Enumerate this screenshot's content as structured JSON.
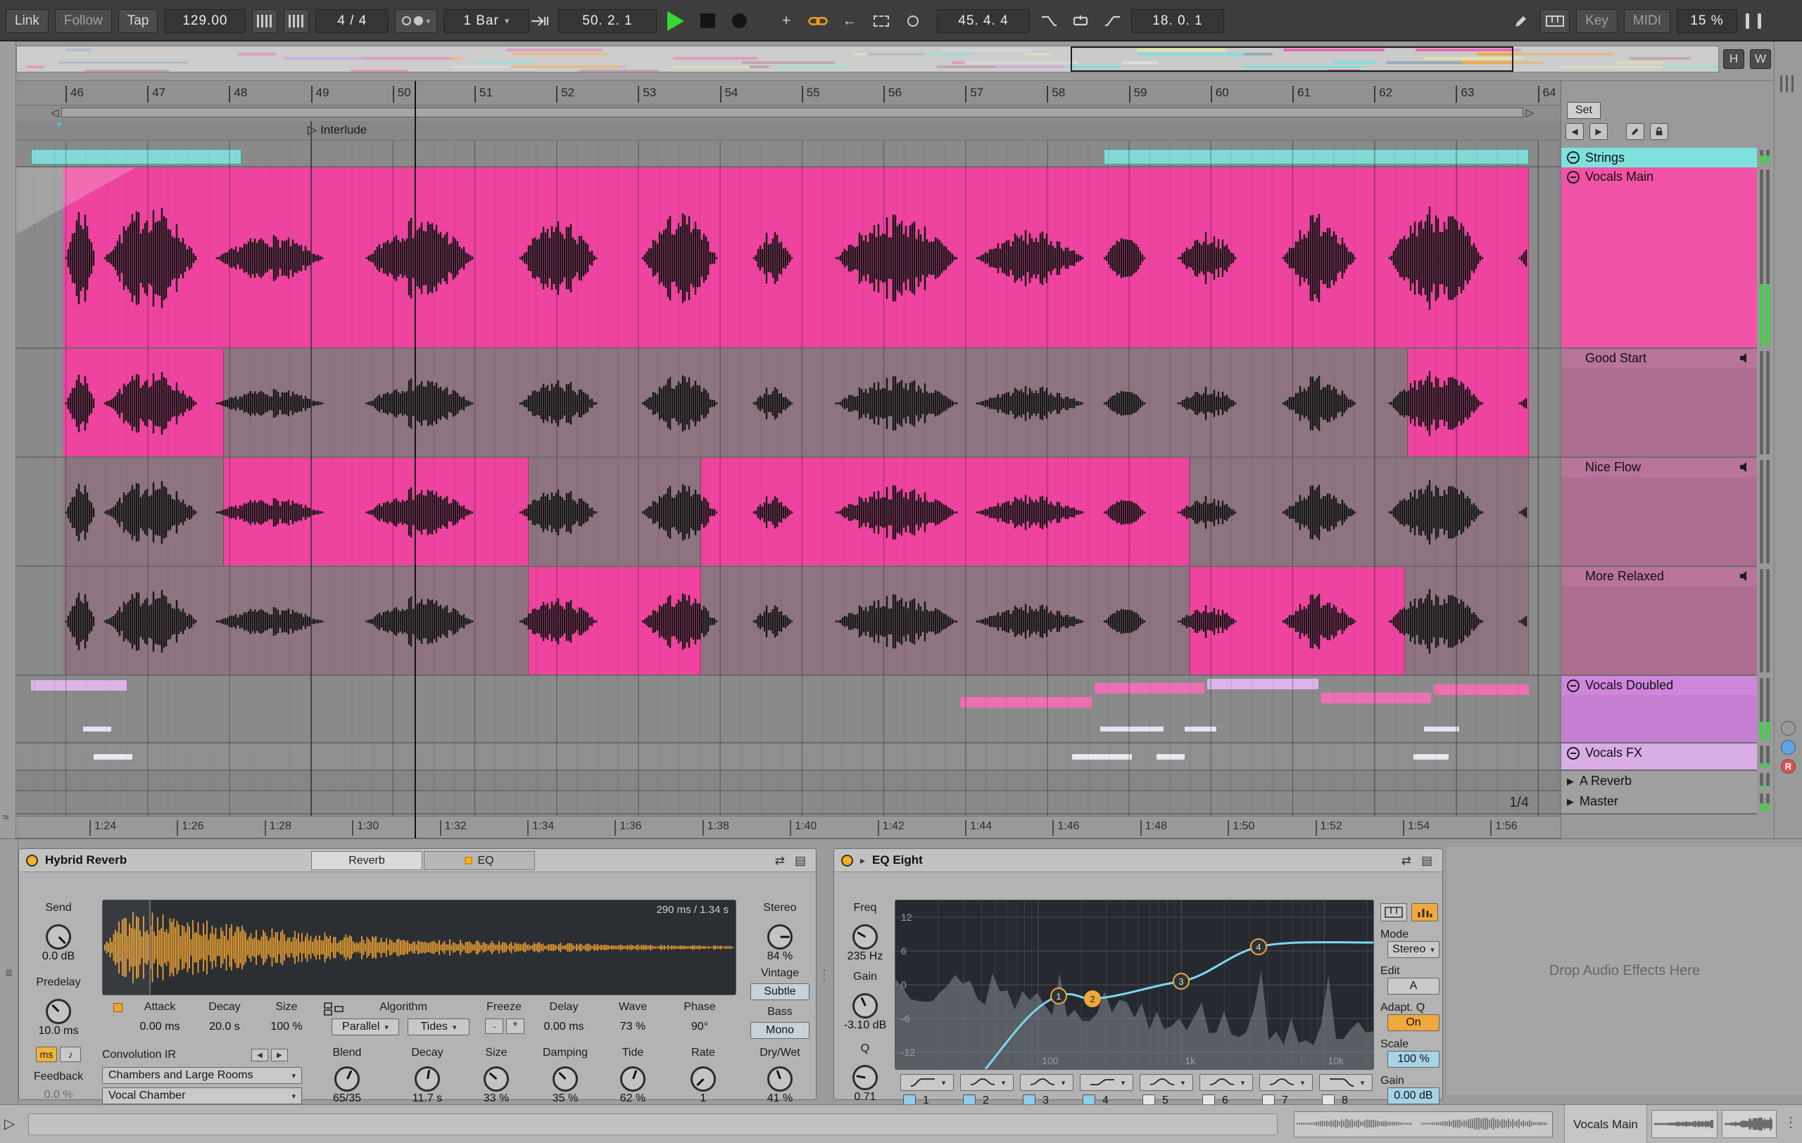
{
  "transport": {
    "link_label": "Link",
    "follow_label": "Follow",
    "tap_label": "Tap",
    "tempo": "129.00",
    "time_signature": "4 / 4",
    "quantize": "1 Bar",
    "arrangement_position": "50. 2. 1",
    "loop_start": "45. 4. 4",
    "loop_length": "18. 0. 1",
    "key_label": "Key",
    "midi_label": "MIDI",
    "cpu_load": "15 %"
  },
  "overview": {
    "fit_height": "H",
    "fit_width": "W"
  },
  "arrangement": {
    "set_label": "Set",
    "locator_label": "Interlude",
    "grid_value": "1/4",
    "bar_numbers": [
      "46",
      "47",
      "48",
      "49",
      "50",
      "51",
      "52",
      "53",
      "54",
      "55",
      "56",
      "57",
      "58",
      "59",
      "60",
      "61",
      "62",
      "63",
      "64"
    ],
    "time_labels": [
      "1:24",
      "1:26",
      "1:28",
      "1:30",
      "1:32",
      "1:34",
      "1:36",
      "1:38",
      "1:40",
      "1:42",
      "1:44",
      "1:46",
      "1:48",
      "1:50",
      "1:52",
      "1:54",
      "1:56"
    ]
  },
  "tracks": [
    {
      "name": "Strings",
      "color": "#7de2dc",
      "kind": "group"
    },
    {
      "name": "Vocals Main",
      "color": "#f053a5",
      "kind": "group"
    },
    {
      "name": "Good Start",
      "color": "#b8749a",
      "kind": "take"
    },
    {
      "name": "Nice Flow",
      "color": "#b8749a",
      "kind": "take"
    },
    {
      "name": "More Relaxed",
      "color": "#b8749a",
      "kind": "take"
    },
    {
      "name": "Vocals Doubled",
      "color": "#cf86dd",
      "kind": "group"
    },
    {
      "name": "Vocals FX",
      "color": "#d9aee7",
      "kind": "group"
    },
    {
      "name": "A Reverb",
      "color": "#a0a0a0",
      "kind": "return"
    },
    {
      "name": "Master",
      "color": "#a0a0a0",
      "kind": "master"
    }
  ],
  "colors": {
    "clip_active": "#ee439e",
    "clip_muted": "#8e7380",
    "clip_strings": "#82e1db",
    "accent_orange": "#f2a431",
    "eq_curve": "#7fd6f2",
    "play_green": "#35d933"
  },
  "hybrid_reverb": {
    "title": "Hybrid Reverb",
    "tabs": [
      "Reverb",
      "EQ"
    ],
    "ir_time_label": "290 ms / 1.34 s",
    "send": {
      "label": "Send",
      "value": "0.0 dB"
    },
    "predelay": {
      "label": "Predelay",
      "value": "10.0 ms"
    },
    "predelay_unit_ms": "ms",
    "predelay_unit_sync": "♪",
    "feedback": {
      "label": "Feedback",
      "value": "0.0 %"
    },
    "attack": {
      "label": "Attack",
      "value": "0.00 ms"
    },
    "decay_ir": {
      "label": "Decay",
      "value": "20.0 s"
    },
    "size_ir": {
      "label": "Size",
      "value": "100 %"
    },
    "algorithm_label": "Algorithm",
    "routing_value": "Parallel",
    "algorithm_value": "Tides",
    "freeze_label": "Freeze",
    "delay": {
      "label": "Delay",
      "value": "0.00 ms"
    },
    "wave": {
      "label": "Wave",
      "value": "73 %"
    },
    "phase": {
      "label": "Phase",
      "value": "90°"
    },
    "convolution_label": "Convolution IR",
    "ir_category": "Chambers and Large Rooms",
    "ir_name": "Vocal Chamber",
    "blend": {
      "label": "Blend",
      "value": "65/35"
    },
    "decay": {
      "label": "Decay",
      "value": "11.7 s"
    },
    "size": {
      "label": "Size",
      "value": "33 %"
    },
    "damping": {
      "label": "Damping",
      "value": "35 %"
    },
    "tide": {
      "label": "Tide",
      "value": "62 %"
    },
    "rate": {
      "label": "Rate",
      "value": "1"
    },
    "stereo": {
      "label": "Stereo",
      "value": "84 %"
    },
    "vintage_label": "Vintage",
    "vintage_value": "Subtle",
    "bass_label": "Bass",
    "bass_value": "Mono",
    "dry_wet": {
      "label": "Dry/Wet",
      "value": "41 %"
    }
  },
  "eq_eight": {
    "title": "EQ Eight",
    "freq": {
      "label": "Freq",
      "value": "235 Hz"
    },
    "gain": {
      "label": "Gain",
      "value": "-3.10 dB"
    },
    "q": {
      "label": "Q",
      "value": "0.71"
    },
    "db_labels": [
      "12",
      "6",
      "0",
      "-6",
      "-12"
    ],
    "freq_axis_labels": [
      "100",
      "1k",
      "10k"
    ],
    "bands": [
      {
        "num": "1",
        "on": true
      },
      {
        "num": "2",
        "on": true
      },
      {
        "num": "3",
        "on": true
      },
      {
        "num": "4",
        "on": true
      },
      {
        "num": "5",
        "on": false
      },
      {
        "num": "6",
        "on": false
      },
      {
        "num": "7",
        "on": false
      },
      {
        "num": "8",
        "on": false
      }
    ],
    "mode_label": "Mode",
    "mode_value": "Stereo",
    "edit_label": "Edit",
    "edit_value": "A",
    "adapt_q_label": "Adapt. Q",
    "adapt_q_value": "On",
    "scale_label": "Scale",
    "scale_value": "100 %",
    "out_gain_label": "Gain",
    "out_gain_value": "0.00 dB"
  },
  "drop_zone_label": "Drop Audio Effects Here",
  "status_bar": {
    "clip_name": "Vocals Main"
  }
}
